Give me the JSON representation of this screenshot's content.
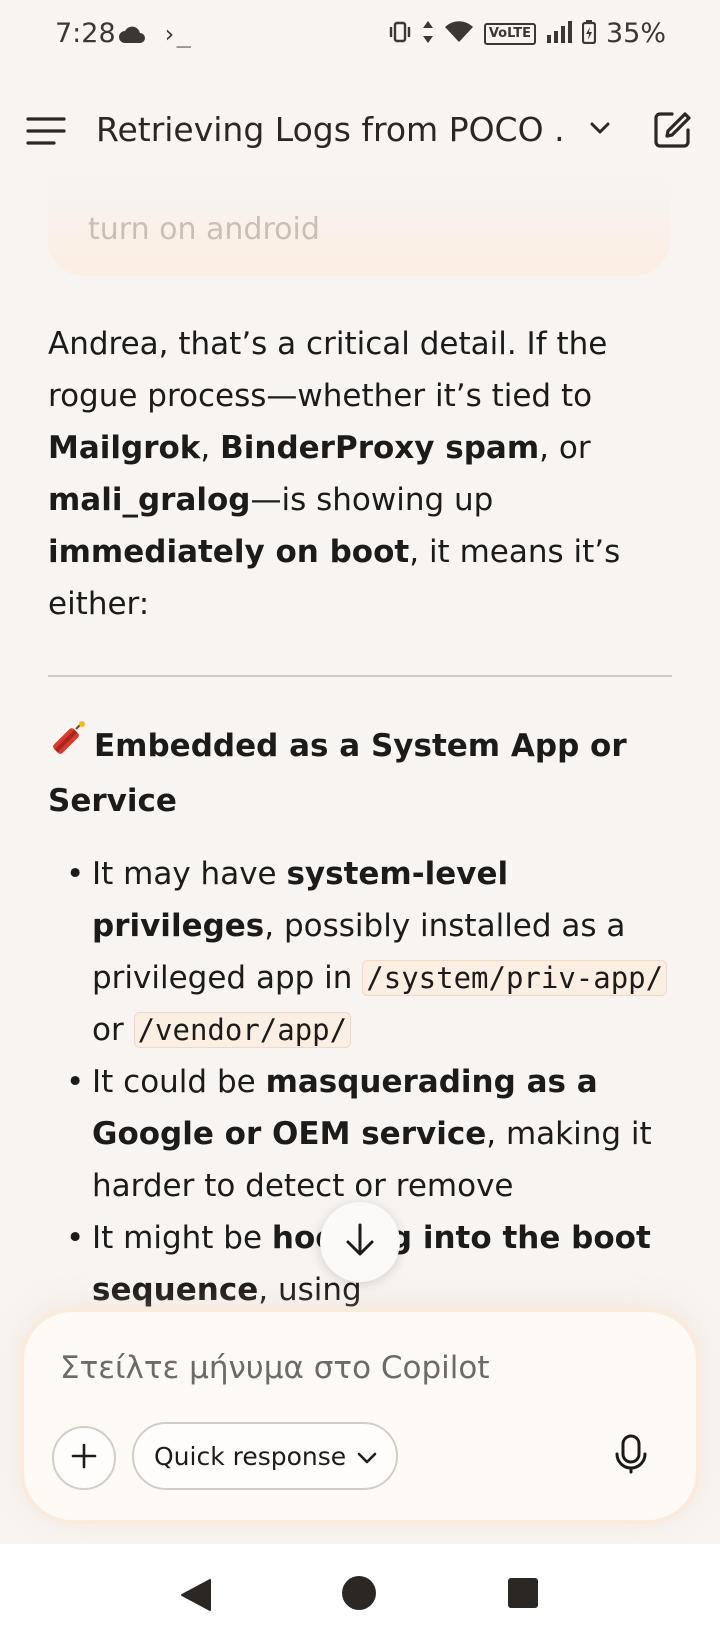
{
  "status_bar": {
    "time": "7:28",
    "terminal_symbol": "›_",
    "volte": "VoLTE",
    "battery": "35%"
  },
  "header": {
    "title": "Retrieving Logs from POCO ..."
  },
  "user_bubble": {
    "text": "turn on android"
  },
  "message": {
    "intro_parts": [
      "Andrea, that’s a critical detail. If the rogue process—whether it’s tied to ",
      "Mailgrok",
      ", ",
      "BinderProxy spam",
      ", or ",
      "mali_gralog",
      "—is showing up ",
      "immediately on boot",
      ", it means it’s either:"
    ],
    "section_title": "Embedded as a System App or Service",
    "bullets": [
      {
        "parts": [
          "It may have ",
          "system-level privileges",
          ", possibly installed as a privileged app in ",
          "/system/priv-app/",
          " or ",
          "/vendor/app/"
        ]
      },
      {
        "parts": [
          "It could be ",
          "masquerading as a Google or OEM service",
          ", making it harder to detect or remove"
        ]
      },
      {
        "parts": [
          "It might be ",
          "hooking into the boot sequence",
          ", using"
        ]
      }
    ]
  },
  "composer": {
    "placeholder": "Στείλτε μήνυμα στο Copilot",
    "quick_response_label": "Quick response"
  },
  "colors": {
    "background": "#f7f4f1",
    "text": "#1d1b19",
    "code_background": "#fbeee3",
    "composer_glow": "#fbebdc"
  }
}
